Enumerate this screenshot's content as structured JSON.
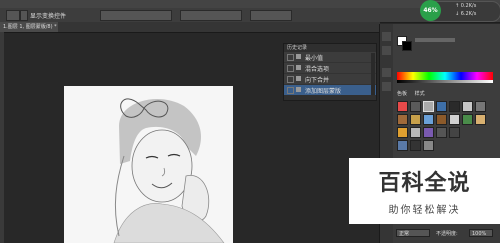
{
  "options_bar": {
    "label": "显示变换控件"
  },
  "document_tab": {
    "title": "1.图层 1, 图层蒙版/8) *"
  },
  "history_panel": {
    "header": "历史记录",
    "items": [
      {
        "label": "最小值",
        "selected": false
      },
      {
        "label": "混合选项",
        "selected": false
      },
      {
        "label": "向下合并",
        "selected": false
      },
      {
        "label": "添加图层蒙版",
        "selected": true
      }
    ]
  },
  "right_panel": {
    "tabs": [
      "色板",
      "样式"
    ]
  },
  "speed_widget": {
    "percent": "46%",
    "line1": "↑ 0.2K/s",
    "line2": "↓ 6.2K/s"
  },
  "layers_bottom": {
    "mode": "正常",
    "opacity_label": "不透明度:",
    "opacity_value": "100%"
  },
  "watermark": {
    "title": "百科全说",
    "subtitle": "助你轻松解决"
  },
  "colors": {
    "accent": "#3a5f8c",
    "speed_green": "#2aa04a"
  }
}
